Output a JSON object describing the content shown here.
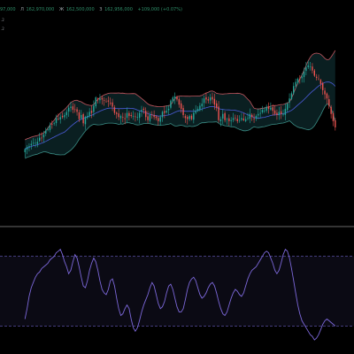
{
  "header": {
    "ohlc": [
      {
        "sym": "",
        "value": "97,000"
      },
      {
        "sym": "Л",
        "value": "162,970,000"
      },
      {
        "sym": "Ж",
        "value": "162,500,000"
      },
      {
        "sym": "З",
        "value": "162,956,000"
      }
    ],
    "change": "+109,000 (+0.07%)",
    "indicator_lines": [
      ".2",
      ".2"
    ]
  },
  "colors": {
    "up": "#26a69a",
    "down": "#ef5350",
    "bb_upper": "#c2565f",
    "bb_lower": "#3a8c84",
    "bb_basis": "#4a5bd6",
    "bb_fill": "#0d2a2c",
    "rsi_line": "#7b67d8",
    "rsi_band": "#6c5fc7"
  },
  "chart_data": [
    {
      "type": "candlestick",
      "title": "",
      "overlay": "bollinger-bands",
      "n": 150,
      "value_range": [
        154.8,
        168.5
      ],
      "x_window": [
        -12,
        158
      ],
      "closes": [
        157.5,
        157.7,
        157.8,
        158.0,
        158.1,
        158.1,
        158.2,
        158.6,
        158.6,
        158.9,
        159.3,
        159.4,
        159.8,
        159.9,
        160.0,
        160.5,
        160.4,
        160.6,
        160.6,
        160.8,
        161.1,
        161.5,
        161.6,
        161.3,
        161.3,
        161.1,
        160.4,
        160.8,
        160.0,
        160.6,
        160.7,
        161.1,
        161.0,
        161.7,
        162.5,
        162.3,
        162.4,
        162.3,
        162.2,
        162.1,
        162.1,
        161.9,
        161.6,
        161.0,
        160.9,
        160.6,
        160.7,
        160.6,
        160.4,
        161.0,
        160.7,
        160.7,
        160.7,
        160.6,
        160.6,
        161.0,
        161.3,
        161.3,
        160.6,
        160.3,
        160.8,
        160.8,
        160.6,
        160.5,
        160.2,
        160.6,
        161.1,
        161.0,
        161.2,
        161.4,
        162.2,
        162.5,
        162.6,
        162.3,
        161.8,
        161.4,
        160.8,
        160.5,
        160.4,
        160.7,
        160.4,
        161.0,
        161.2,
        161.4,
        161.7,
        161.9,
        162.4,
        162.3,
        162.2,
        162.5,
        162.3,
        161.8,
        161.5,
        160.3,
        160.4,
        160.9,
        160.3,
        160.4,
        160.2,
        160.3,
        160.5,
        160.5,
        160.2,
        160.3,
        160.5,
        160.3,
        160.4,
        160.5,
        160.9,
        160.6,
        160.4,
        160.7,
        160.9,
        161.0,
        161.3,
        161.2,
        161.6,
        161.4,
        161.5,
        161.2,
        160.9,
        160.8,
        161.1,
        160.9,
        160.9,
        161.4,
        161.9,
        162.4,
        162.9,
        163.6,
        164.0,
        164.3,
        164.3,
        164.5,
        165.0,
        165.4,
        165.6,
        165.5,
        165.1,
        164.6,
        164.4,
        164.3,
        163.8,
        163.2,
        162.8,
        162.4,
        161.7,
        160.9,
        160.2,
        159.6
      ]
    },
    {
      "type": "line",
      "title": "",
      "indicator": "oscillator",
      "levels": [
        70,
        30
      ],
      "y_range": [
        20,
        80
      ],
      "values": [
        34,
        40,
        47,
        52,
        55,
        58,
        60,
        61,
        63,
        64,
        65,
        66,
        68,
        69,
        70,
        72,
        73,
        74,
        71,
        67,
        64,
        60,
        62,
        67,
        71,
        69,
        64,
        58,
        53,
        52,
        56,
        62,
        66,
        69,
        67,
        62,
        56,
        51,
        49,
        48,
        51,
        56,
        57,
        53,
        46,
        40,
        36,
        37,
        40,
        42,
        40,
        34,
        29,
        27,
        29,
        33,
        38,
        42,
        45,
        48,
        52,
        55,
        53,
        48,
        43,
        40,
        41,
        44,
        49,
        53,
        54,
        51,
        46,
        41,
        38,
        38,
        40,
        45,
        51,
        55,
        57,
        58,
        56,
        52,
        48,
        46,
        47,
        49,
        52,
        54,
        55,
        53,
        49,
        44,
        40,
        37,
        36,
        38,
        42,
        46,
        49,
        51,
        50,
        48,
        47,
        49,
        53,
        57,
        60,
        62,
        63,
        64,
        66,
        68,
        70,
        72,
        73,
        72,
        69,
        66,
        62,
        60,
        62,
        66,
        71,
        74,
        73,
        69,
        63,
        56,
        49,
        42,
        37,
        33,
        31,
        29,
        27,
        25,
        24,
        22,
        23,
        25,
        28,
        31,
        33,
        34,
        33,
        32,
        31,
        30
      ]
    }
  ]
}
